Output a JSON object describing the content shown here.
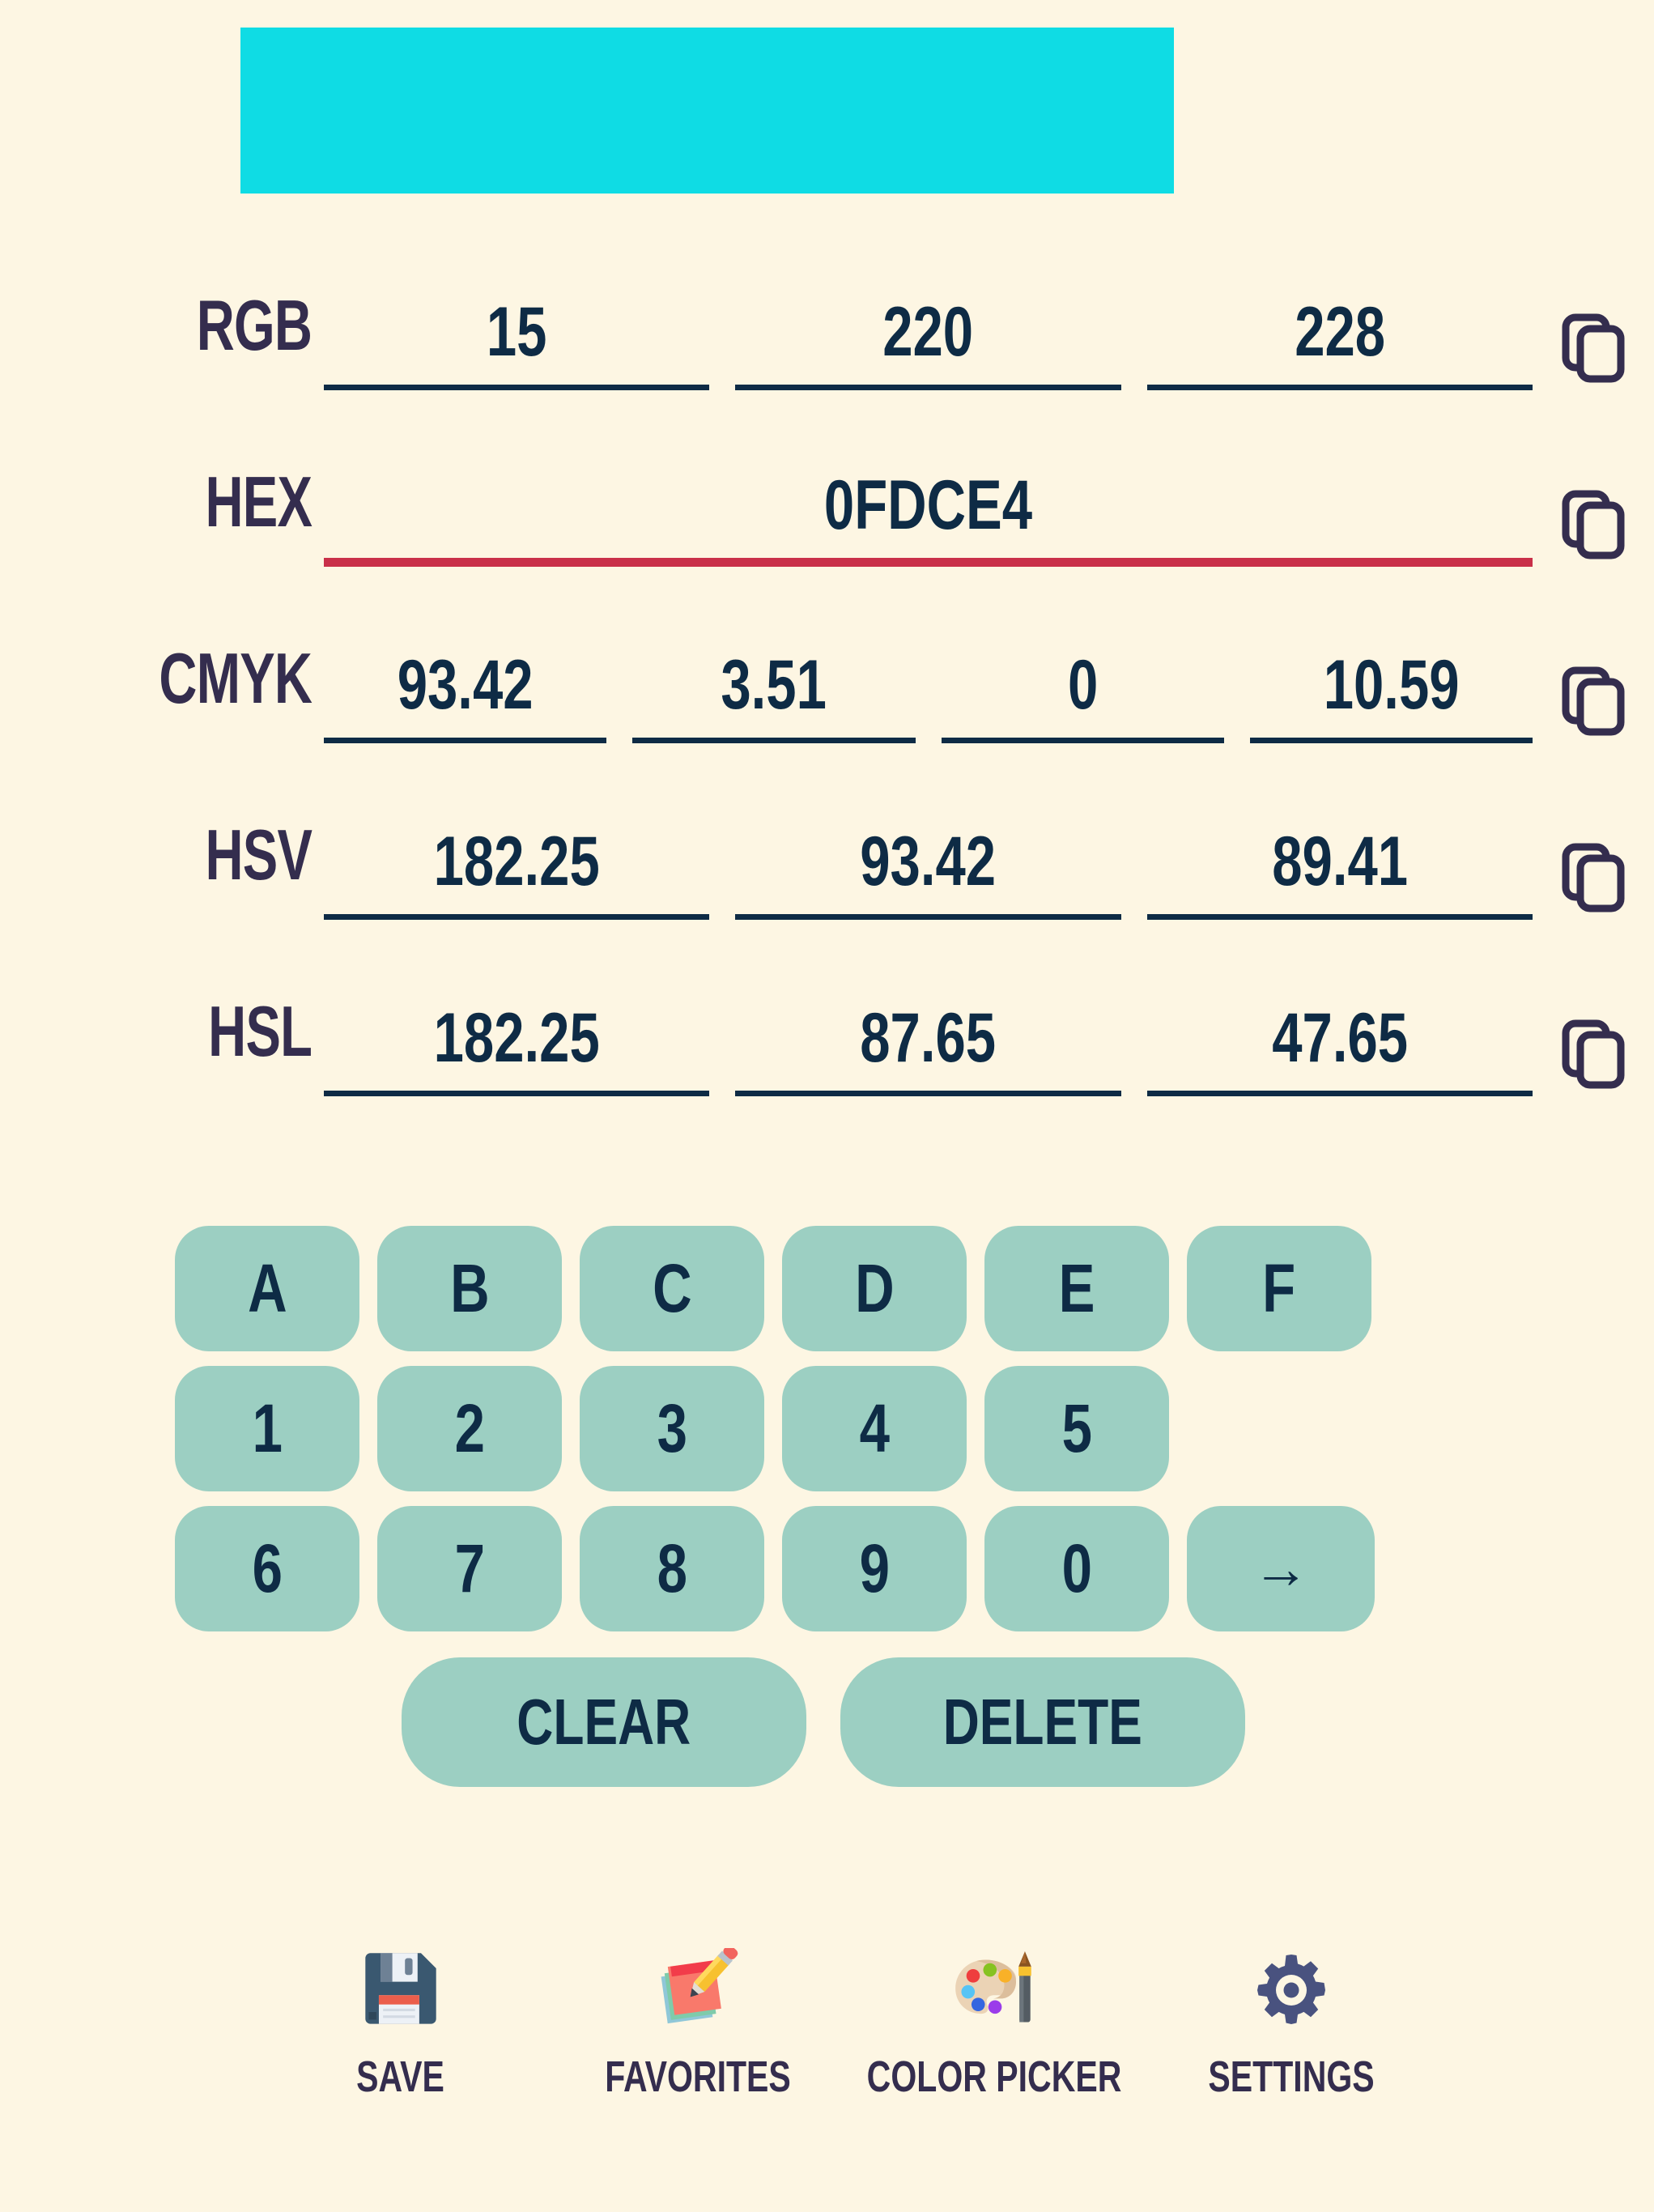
{
  "theme": {
    "background": "#FDF6E3",
    "text_dark": "#0E2B45",
    "label_color": "#342D4E",
    "key_fill": "#9CCFC2",
    "active_underline": "#C93049"
  },
  "preview": {
    "swatch_color": "#0FDCE4",
    "name": "color-preview-swatch"
  },
  "conversions": [
    {
      "label": "RGB",
      "active": false,
      "fields": [
        "15",
        "220",
        "228"
      ],
      "copy_label": "copy-icon"
    },
    {
      "label": "HEX",
      "active": true,
      "fields": [
        "0FDCE4"
      ],
      "copy_label": "copy-icon"
    },
    {
      "label": "CMYK",
      "active": false,
      "fields": [
        "93.42",
        "3.51",
        "0",
        "10.59"
      ],
      "copy_label": "copy-icon"
    },
    {
      "label": "HSV",
      "active": false,
      "fields": [
        "182.25",
        "93.42",
        "89.41"
      ],
      "copy_label": "copy-icon"
    },
    {
      "label": "HSL",
      "active": false,
      "fields": [
        "182.25",
        "87.65",
        "47.65"
      ],
      "copy_label": "copy-icon"
    }
  ],
  "keypad": {
    "rows": [
      [
        "A",
        "B",
        "C",
        "D",
        "E",
        "F"
      ],
      [
        "1",
        "2",
        "3",
        "4",
        "5"
      ],
      [
        "6",
        "7",
        "8",
        "9",
        "0",
        "→"
      ]
    ],
    "arrow_glyph": "→",
    "actions": [
      {
        "label": "CLEAR",
        "name": "clear-button"
      },
      {
        "label": "DELETE",
        "name": "delete-button"
      }
    ]
  },
  "bottom_nav": [
    {
      "label": "SAVE",
      "icon": "floppy-disk-icon",
      "name": "nav-item-save"
    },
    {
      "label": "FAVORITES",
      "icon": "memo-icon",
      "name": "nav-item-favorites"
    },
    {
      "label": "COLOR PICKER",
      "icon": "palette-icon",
      "name": "nav-item-color-picker"
    },
    {
      "label": "SETTINGS",
      "icon": "gear-icon",
      "name": "nav-item-settings"
    }
  ]
}
